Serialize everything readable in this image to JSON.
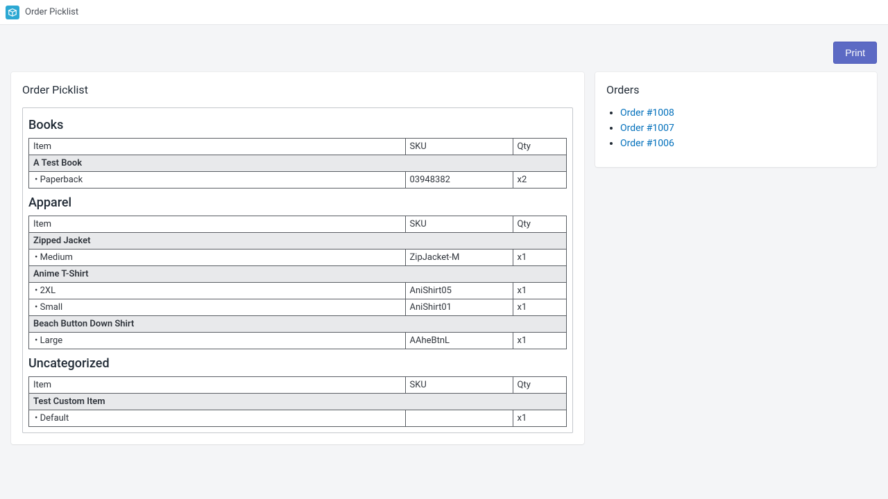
{
  "app_title": "Order Picklist",
  "print_label": "Print",
  "main_title": "Order Picklist",
  "side_title": "Orders",
  "headers": {
    "item": "Item",
    "sku": "SKU",
    "qty": "Qty"
  },
  "orders": [
    {
      "label": "Order #1008"
    },
    {
      "label": "Order #1007"
    },
    {
      "label": "Order #1006"
    }
  ],
  "sections": [
    {
      "title": "Books",
      "groups": [
        {
          "name": "A Test Book",
          "rows": [
            {
              "variant": "Paperback",
              "sku": "03948382",
              "qty": "x2"
            }
          ]
        }
      ]
    },
    {
      "title": "Apparel",
      "groups": [
        {
          "name": "Zipped Jacket",
          "rows": [
            {
              "variant": "Medium",
              "sku": "ZipJacket-M",
              "qty": "x1"
            }
          ]
        },
        {
          "name": "Anime T-Shirt",
          "rows": [
            {
              "variant": "2XL",
              "sku": "AniShirt05",
              "qty": "x1"
            },
            {
              "variant": "Small",
              "sku": "AniShirt01",
              "qty": "x1"
            }
          ]
        },
        {
          "name": "Beach Button Down Shirt",
          "rows": [
            {
              "variant": "Large",
              "sku": "AAheBtnL",
              "qty": "x1"
            }
          ]
        }
      ]
    },
    {
      "title": "Uncategorized",
      "groups": [
        {
          "name": "Test Custom Item",
          "rows": [
            {
              "variant": "Default",
              "sku": "",
              "qty": "x1"
            }
          ]
        }
      ]
    }
  ]
}
